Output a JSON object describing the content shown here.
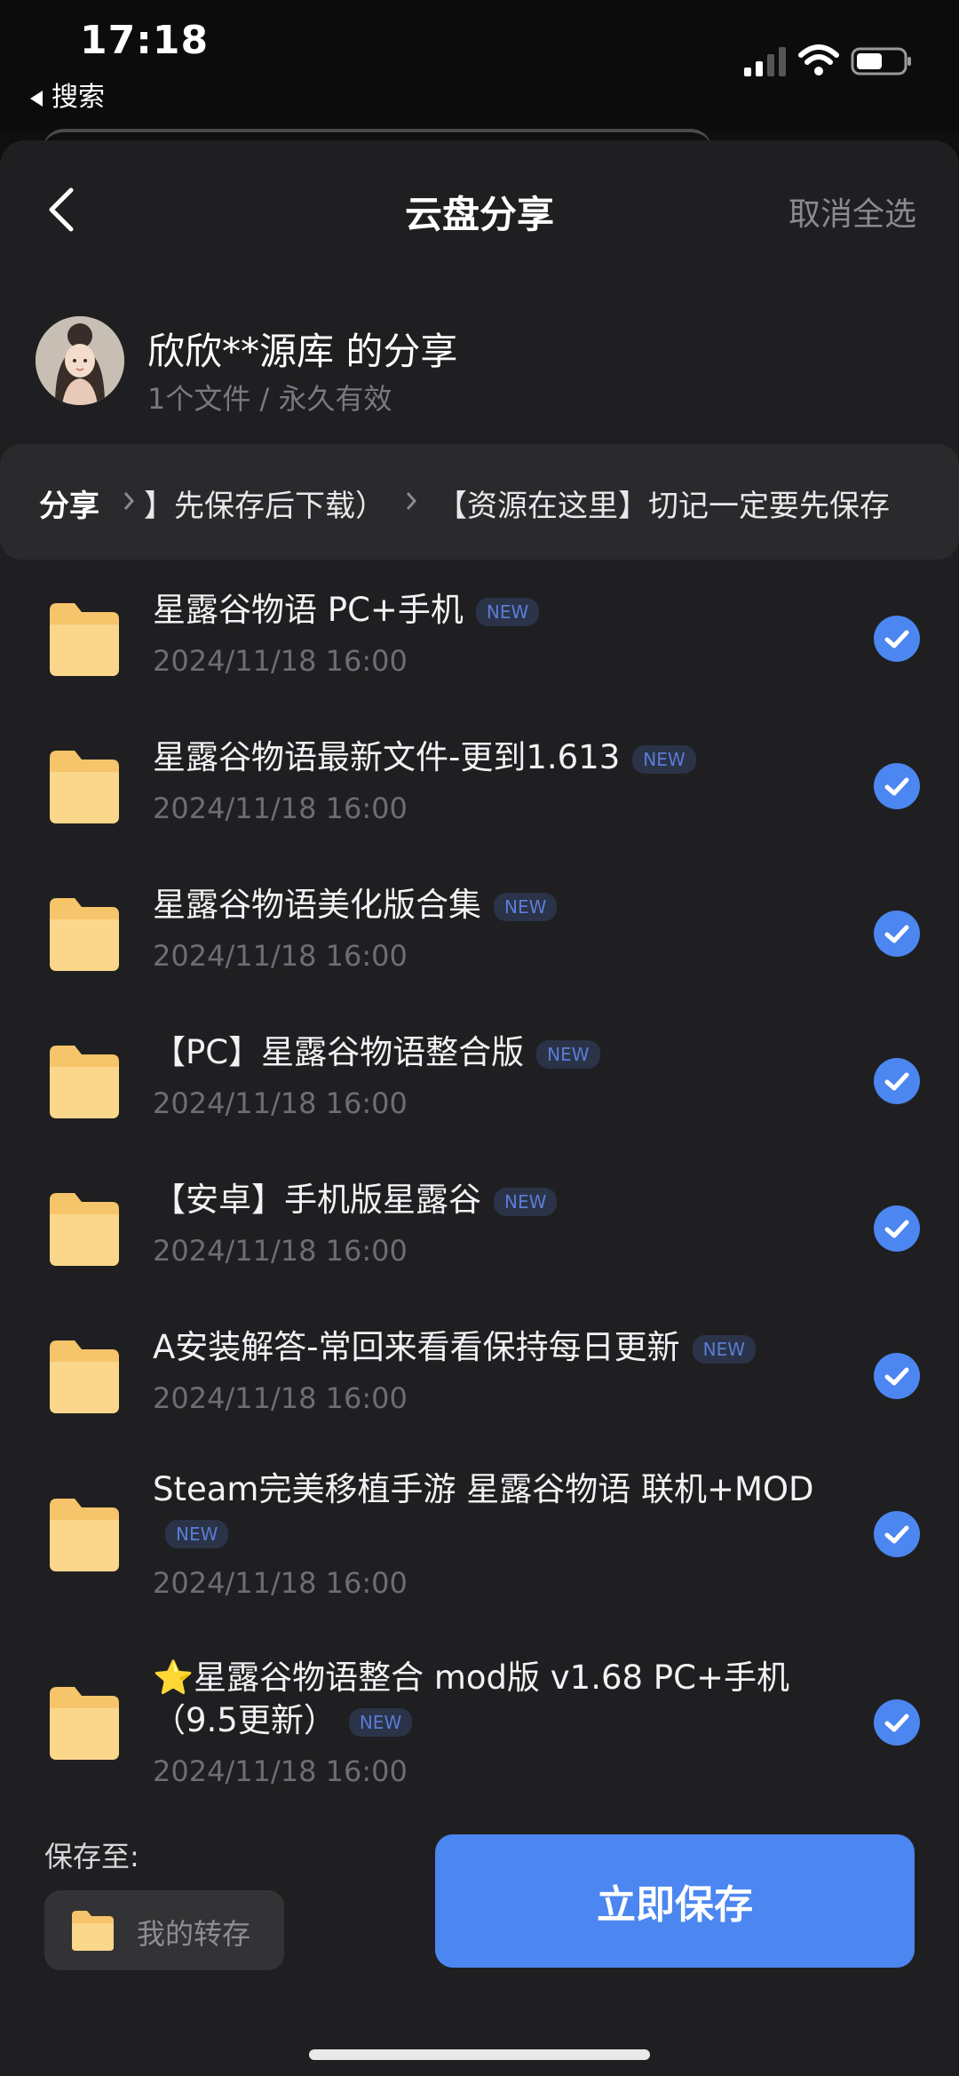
{
  "status": {
    "time": "17:18",
    "back_app": "搜索"
  },
  "nav": {
    "title": "云盘分享",
    "cancel": "取消全选"
  },
  "share": {
    "title": "欣欣**源库 的分享",
    "meta": "1个文件 / 永久有效"
  },
  "breadcrumb": {
    "root": "分享",
    "items": [
      "】先保存后下载）",
      "【资源在这里】切记一定要先保存"
    ]
  },
  "badge_label": "NEW",
  "files": [
    {
      "name": "星露谷物语 PC+手机",
      "date": "2024/11/18 16:00"
    },
    {
      "name": "星露谷物语最新文件-更到1.613",
      "date": "2024/11/18 16:00"
    },
    {
      "name": "星露谷物语美化版合集",
      "date": "2024/11/18 16:00"
    },
    {
      "name": "【PC】星露谷物语整合版",
      "date": "2024/11/18 16:00"
    },
    {
      "name": "【安卓】手机版星露谷",
      "date": "2024/11/18 16:00"
    },
    {
      "name": "A安装解答-常回来看看保持每日更新",
      "date": "2024/11/18 16:00"
    },
    {
      "name": "Steam完美移植手游 星露谷物语 联机+MOD",
      "date": "2024/11/18 16:00"
    },
    {
      "name": "⭐星露谷物语整合 mod版  v1.68 PC+手机（9.5更新）",
      "date": "2024/11/18 16:00"
    }
  ],
  "footer": {
    "save_to_label": "保存至:",
    "destination": "我的转存",
    "save_button": "立即保存"
  },
  "colors": {
    "accent": "#4c86f0",
    "folder": "#f6c46a",
    "background": "#1f1f21"
  }
}
